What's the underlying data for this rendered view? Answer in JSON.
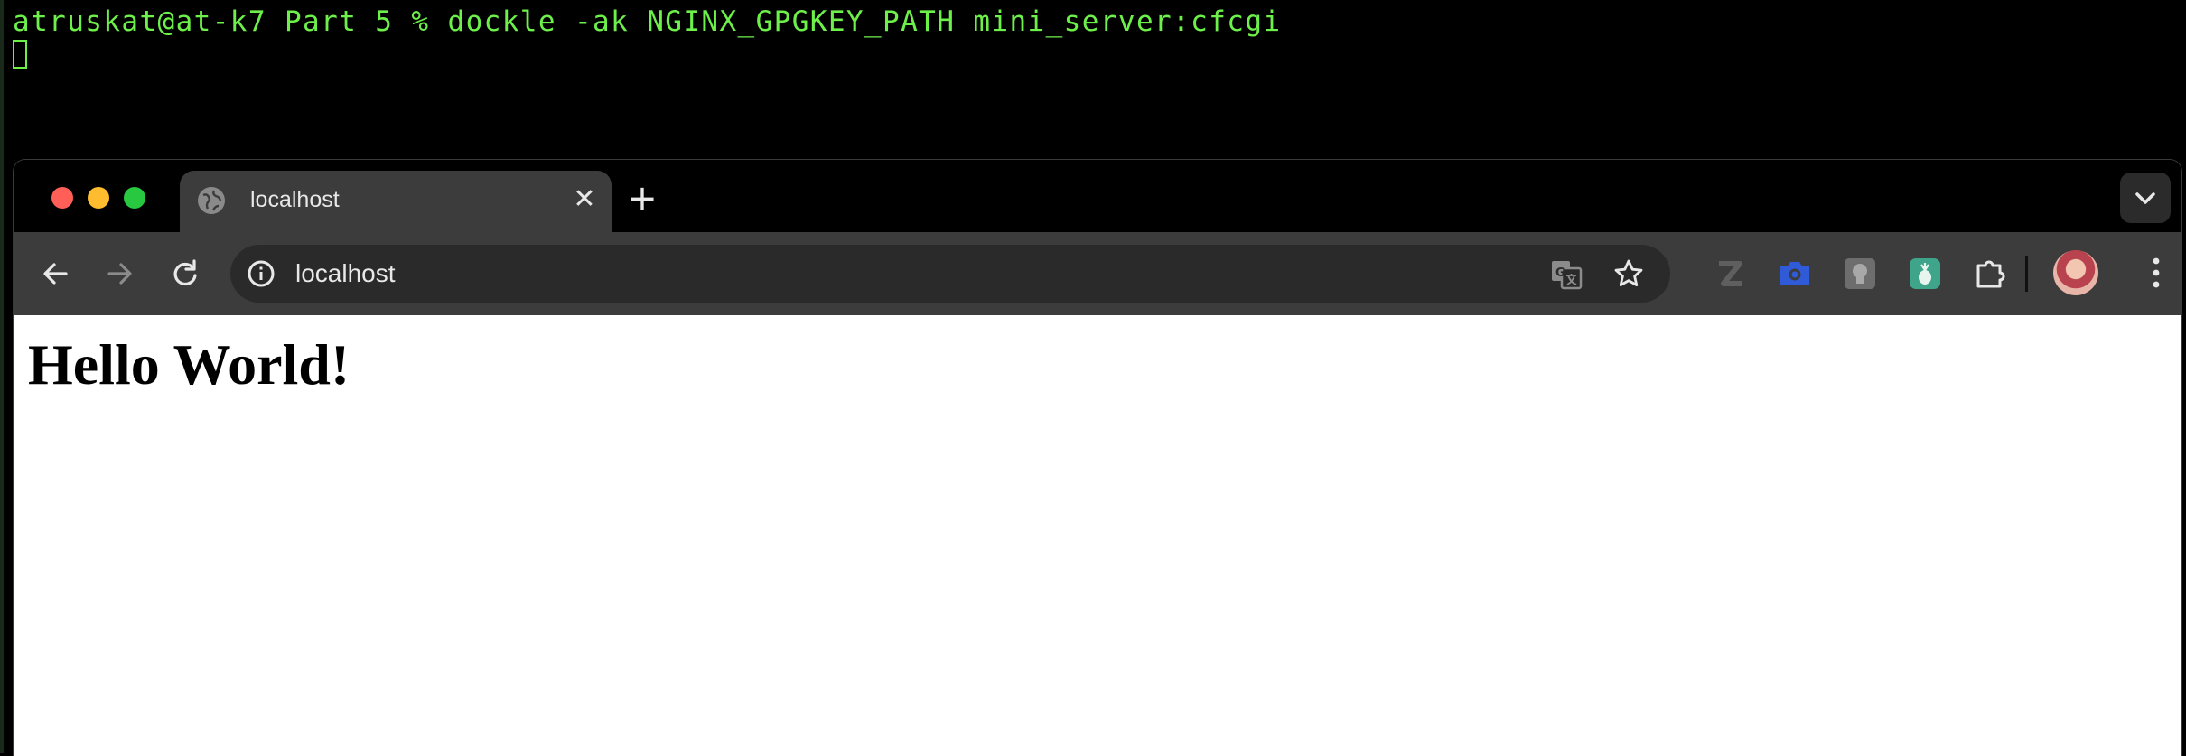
{
  "terminal": {
    "command_line": "atruskat@at-k7 Part 5 % dockle -ak NGINX_GPGKEY_PATH mini_server:cfcgi"
  },
  "browser": {
    "tab": {
      "title": "localhost",
      "close_glyph": "✕",
      "favicon": "globe-icon"
    },
    "new_tab_glyph": "+",
    "address_bar": {
      "url": "localhost",
      "site_info_icon": "info-icon"
    },
    "extensions": [
      "z-extension-icon",
      "camera-extension-icon",
      "lightbulb-extension-icon",
      "pineapple-extension-icon",
      "puzzle-extensions-icon"
    ],
    "colors": {
      "close": "#ff5f57",
      "minimize": "#febc2e",
      "maximize": "#28c840",
      "terminal_text": "#6ef04b",
      "camera_ext": "#2f5bd8",
      "pineapple_ext": "#3fa58a"
    }
  },
  "page": {
    "heading": "Hello World!"
  }
}
